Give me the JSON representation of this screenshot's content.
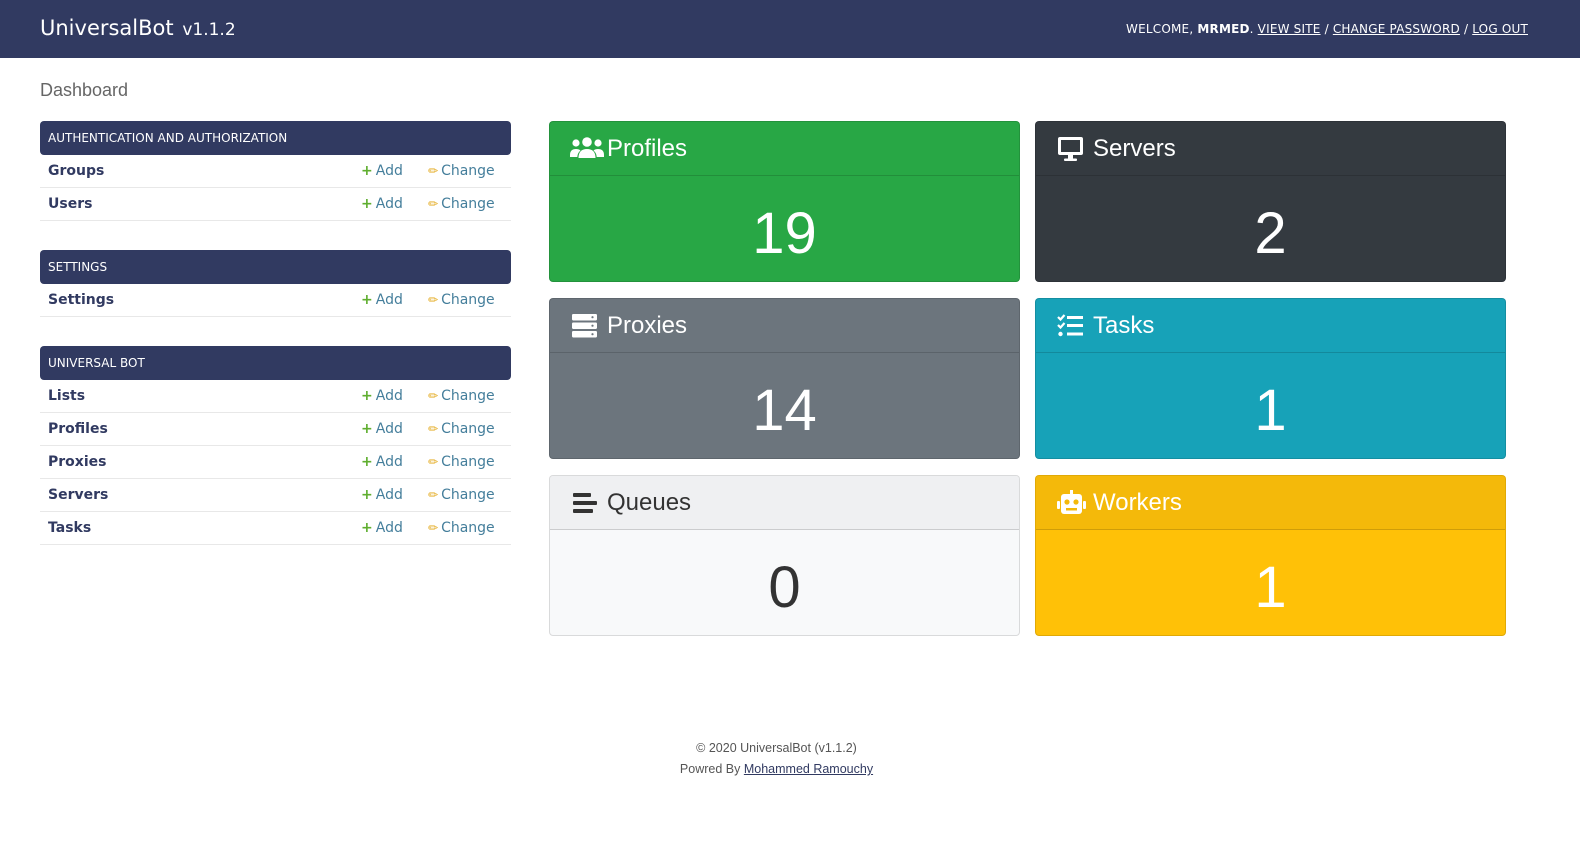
{
  "header": {
    "brand": "UniversalBot",
    "version": "v1.1.2",
    "welcome_prefix": "WELCOME,",
    "username": "MRMED",
    "links": {
      "view_site": "VIEW SITE",
      "change_password": "CHANGE PASSWORD",
      "log_out": "LOG OUT"
    }
  },
  "page_title": "Dashboard",
  "modules": [
    {
      "caption": "Authentication and Authorization",
      "rows": [
        {
          "name": "Groups",
          "add": "Add",
          "change": "Change"
        },
        {
          "name": "Users",
          "add": "Add",
          "change": "Change"
        }
      ]
    },
    {
      "caption": "Settings",
      "rows": [
        {
          "name": "Settings",
          "add": "Add",
          "change": "Change"
        }
      ]
    },
    {
      "caption": "Universal Bot",
      "rows": [
        {
          "name": "Lists",
          "add": "Add",
          "change": "Change"
        },
        {
          "name": "Profiles",
          "add": "Add",
          "change": "Change"
        },
        {
          "name": "Proxies",
          "add": "Add",
          "change": "Change"
        },
        {
          "name": "Servers",
          "add": "Add",
          "change": "Change"
        },
        {
          "name": "Tasks",
          "add": "Add",
          "change": "Change"
        }
      ]
    }
  ],
  "cards": {
    "profiles": {
      "title": "Profiles",
      "count": "19",
      "icon": "users-icon",
      "color": "#28a745"
    },
    "servers": {
      "title": "Servers",
      "count": "2",
      "icon": "desktop-icon",
      "color": "#343a40"
    },
    "proxies": {
      "title": "Proxies",
      "count": "14",
      "icon": "server-icon",
      "color": "#6c757d"
    },
    "tasks": {
      "title": "Tasks",
      "count": "1",
      "icon": "tasks-icon",
      "color": "#17a2b8"
    },
    "queues": {
      "title": "Queues",
      "count": "0",
      "icon": "stream-icon",
      "color": "#f8f9fa"
    },
    "workers": {
      "title": "Workers",
      "count": "1",
      "icon": "robot-icon",
      "color": "#ffc107"
    }
  },
  "footer": {
    "copyright": "© 2020 UniversalBot (v1.1.2)",
    "powered_by": "Powred By",
    "author": "Mohammed Ramouchy"
  }
}
